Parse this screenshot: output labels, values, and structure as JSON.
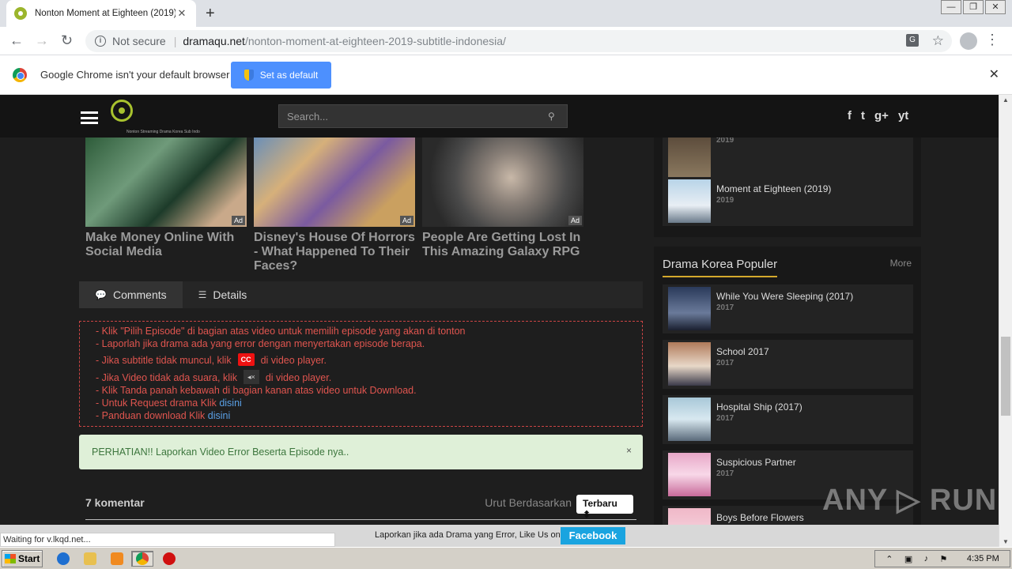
{
  "browser": {
    "tab_title": "Nonton Moment at Eighteen (2019) I",
    "tab_close": "✕",
    "new_tab": "+",
    "security": "Not secure",
    "url_host": "dramaqu.net",
    "url_path": "/nonton-moment-at-eighteen-2019-subtitle-indonesia/",
    "window_controls": [
      "—",
      "❐",
      "✕"
    ]
  },
  "infobar": {
    "message": "Google Chrome isn't your default browser",
    "button": "Set as default",
    "close": "✕"
  },
  "site": {
    "search_placeholder": "Search...",
    "logo_tagline": "Nonton Streaming Drama Korea Sub Indo",
    "socials": [
      "f",
      "t",
      "g+",
      "yt"
    ],
    "ads": [
      {
        "caption": "Make Money Online With Social Media",
        "badge": "Ad"
      },
      {
        "caption": "Disney's House Of Horrors - What Happened To Their Faces?",
        "badge": "Ad"
      },
      {
        "caption": "People Are Getting Lost In This Amazing Galaxy RPG",
        "badge": "Ad"
      }
    ],
    "tabs": [
      {
        "label": "Comments",
        "icon": "comment-icon"
      },
      {
        "label": "Details",
        "icon": "list-icon"
      }
    ],
    "notice": {
      "line1": "- Klik \"Pilih Episode\" di bagian atas video untuk memilih episode yang akan di tonton",
      "line2": "- Laporlah jika drama ada yang error dengan menyertakan episode berapa.",
      "line3a": "- Jika subtitle tidak muncul, klik",
      "line3b": "di video player.",
      "cc": "CC",
      "line4a": "- Jika Video tidak ada suara, klik",
      "line4b": "di video player.",
      "mute": "◂×",
      "line5": "- Klik Tanda panah kebawah di bagian kanan atas video untuk Download.",
      "line6a": "- Untuk Request drama Klik ",
      "line6link": "disini",
      "line7a": "- Panduan download Klik ",
      "line7link": "disini"
    },
    "alert": {
      "text": "PERHATIAN!! Laporkan Video Error Beserta Episode nya..",
      "close": "×"
    },
    "comments": {
      "count": "7 komentar",
      "sort_label": "Urut Berdasarkan",
      "sort_value": "Terbaru ⬍"
    }
  },
  "sidebar": {
    "recent": [
      {
        "title": "",
        "year": "2019"
      },
      {
        "title": "Moment at Eighteen (2019)",
        "year": "2019"
      }
    ],
    "popular_heading": "Drama Korea Populer",
    "more": "More",
    "popular": [
      {
        "title": "While You Were Sleeping (2017)",
        "year": "2017"
      },
      {
        "title": "School 2017",
        "year": "2017"
      },
      {
        "title": "Hospital Ship (2017)",
        "year": "2017"
      },
      {
        "title": "Suspicious Partner",
        "year": "2017"
      },
      {
        "title": "Boys Before Flowers",
        "year": ""
      }
    ]
  },
  "footer_bar": {
    "text": "Laporkan jika ada Drama yang Error, Like Us on",
    "button": "Facebook"
  },
  "status_text": "Waiting for v.lkqd.net...",
  "watermark": "ANY ▷ RUN",
  "taskbar": {
    "start": "Start",
    "clock": "4:35 PM"
  }
}
